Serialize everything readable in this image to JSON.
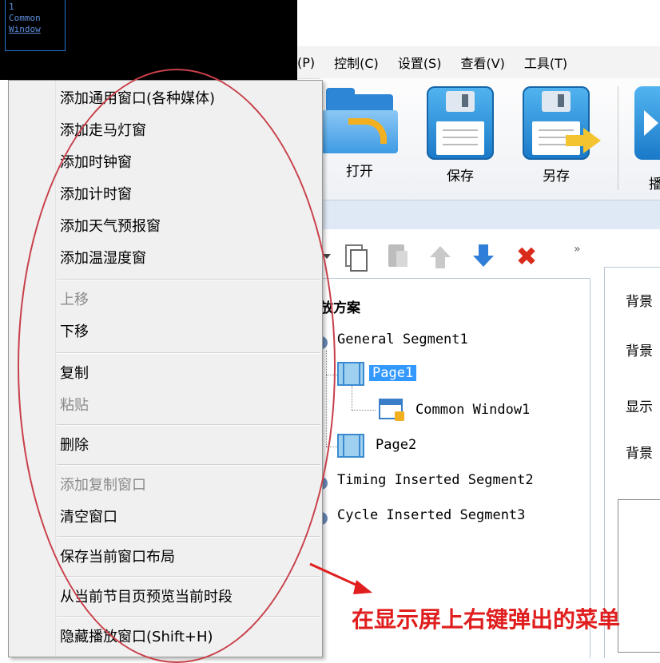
{
  "preview": {
    "window_lines": [
      "1",
      "Common",
      "Window"
    ]
  },
  "menubar": {
    "items": [
      "(P)",
      "控制(C)",
      "设置(S)",
      "查看(V)",
      "工具(T)"
    ]
  },
  "toolbar": {
    "open_label": "打开",
    "save_label": "保存",
    "save_as_label": "另存",
    "play_label": "播"
  },
  "toolbar2": {
    "more_label": "»"
  },
  "tree": {
    "title": "放方案",
    "rows": {
      "seg1": "General Segment1",
      "page1": "Page1",
      "cw1": "Common Window1",
      "page2": "Page2",
      "seg2": "Timing Inserted Segment2",
      "seg3": "Cycle Inserted Segment3"
    }
  },
  "props": {
    "labels": [
      "背景",
      "背景",
      "显示",
      "背景"
    ]
  },
  "context_menu": {
    "add_common_window": "添加通用窗口(各种媒体)",
    "add_marquee": "添加走马灯窗",
    "add_clock": "添加时钟窗",
    "add_timer": "添加计时窗",
    "add_weather": "添加天气预报窗",
    "add_temp_humidity": "添加温湿度窗",
    "move_up": "上移",
    "move_down": "下移",
    "copy": "复制",
    "paste": "粘贴",
    "delete": "删除",
    "add_copy_window": "添加复制窗口",
    "clear_windows": "清空窗口",
    "save_layout": "保存当前窗口布局",
    "preview_from_page": "从当前节目页预览当前时段",
    "hide_play_window": "隐藏播放窗口(Shift+H)"
  },
  "annotation": {
    "text": "在显示屏上右键弹出的菜单",
    "color": "#e01e1e"
  }
}
